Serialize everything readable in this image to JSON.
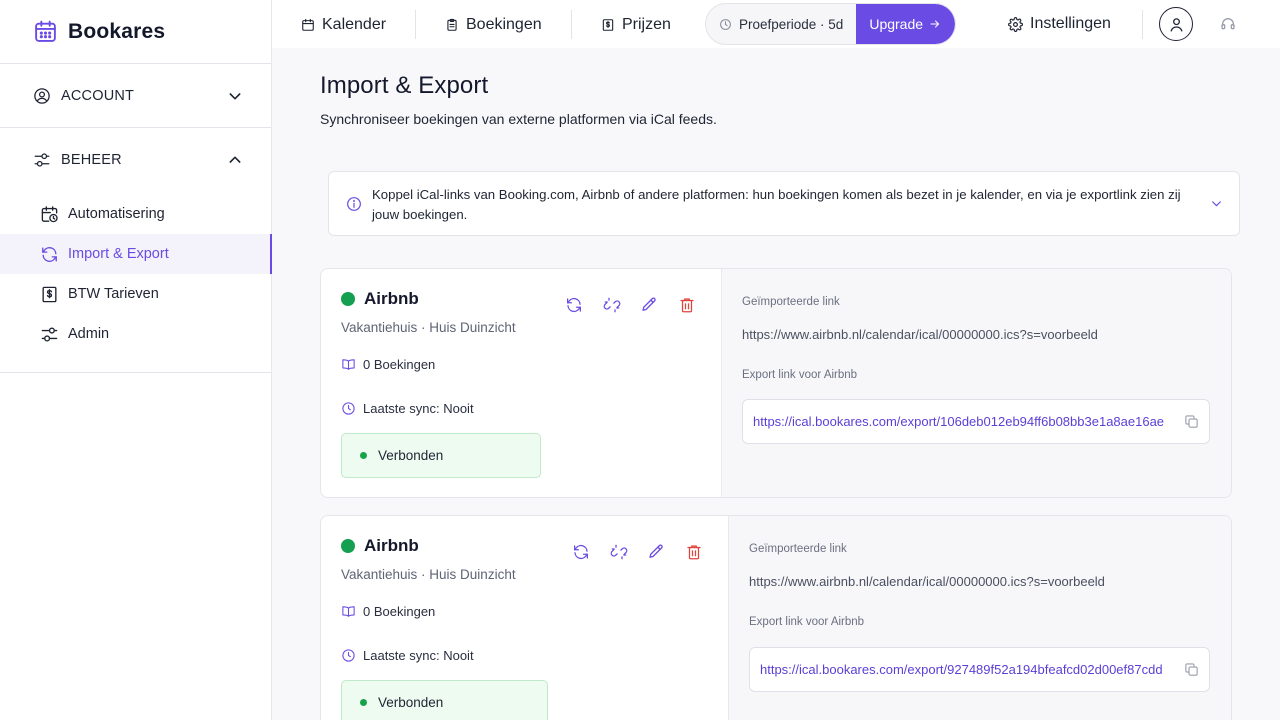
{
  "app": {
    "name": "Bookares"
  },
  "sidebar": {
    "sections": [
      {
        "label": "ACCOUNT",
        "expanded": false,
        "icon": "user-circle-icon"
      },
      {
        "label": "BEHEER",
        "expanded": true,
        "icon": "sliders-icon"
      }
    ],
    "items": [
      {
        "label": "Automatisering",
        "icon": "calendar-clock-icon",
        "active": false
      },
      {
        "label": "Import & Export",
        "icon": "sync-icon",
        "active": true
      },
      {
        "label": "BTW Tarieven",
        "icon": "receipt-icon",
        "active": false
      },
      {
        "label": "Admin",
        "icon": "sliders-icon",
        "active": false
      }
    ]
  },
  "topbar": {
    "nav": [
      {
        "label": "Kalender",
        "icon": "calendar-icon"
      },
      {
        "label": "Boekingen",
        "icon": "clipboard-icon"
      },
      {
        "label": "Prijzen",
        "icon": "receipt-icon"
      }
    ],
    "trial": "Proefperiode · 5d",
    "upgrade": "Upgrade",
    "settings": "Instellingen"
  },
  "page": {
    "title": "Import & Export",
    "subtitle": "Synchroniseer boekingen van externe platformen via iCal feeds.",
    "info": "Koppel iCal-links van Booking.com, Airbnb of andere platformen: hun boekingen komen als bezet in je kalender, en via je exportlink zien zij jouw boekingen."
  },
  "feeds": [
    {
      "name": "Airbnb",
      "subtitle": "Vakantiehuis · Huis Duinzicht",
      "bookings": "0 Boekingen",
      "last_sync": "Laatste sync: Nooit",
      "status": "Verbonden",
      "imported_label": "Geïmporteerde link",
      "imported_url": "https://www.airbnb.nl/calendar/ical/00000000.ics?s=voorbeeld",
      "export_label": "Export link voor Airbnb",
      "export_url": "https://ical.bookares.com/export/106deb012eb94ff6b08bb3e1a8ae16ae"
    },
    {
      "name": "Airbnb",
      "subtitle": "Vakantiehuis · Huis Duinzicht",
      "bookings": "0 Boekingen",
      "last_sync": "Laatste sync: Nooit",
      "status": "Verbonden",
      "imported_label": "Geïmporteerde link",
      "imported_url": "https://www.airbnb.nl/calendar/ical/00000000.ics?s=voorbeeld",
      "export_label": "Export link voor Airbnb",
      "export_url": "https://ical.bookares.com/export/927489f52a194bfeafcd02d00ef87cdd"
    }
  ],
  "colors": {
    "accent": "#6a4be4",
    "success": "#14a050",
    "danger": "#e0443e"
  }
}
